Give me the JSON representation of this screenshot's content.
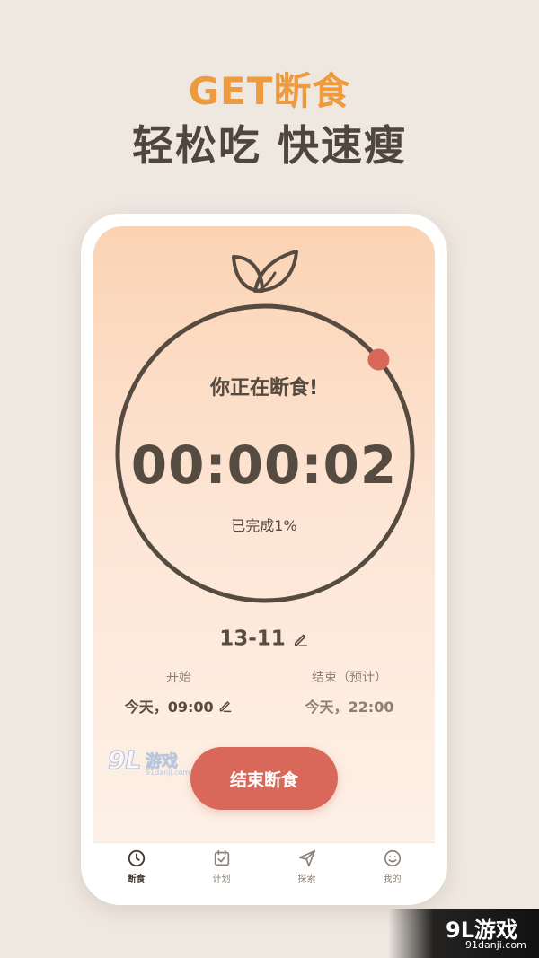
{
  "promo": {
    "title": "GET断食",
    "subtitle": "轻松吃 快速瘦"
  },
  "timer": {
    "status": "你正在断食!",
    "elapsed": "00:00:02",
    "progress_text": "已完成1%",
    "progress_fraction": 0.01
  },
  "plan": {
    "label": "13-11"
  },
  "start": {
    "label": "开始",
    "value": "今天，09:00"
  },
  "end": {
    "label": "结束（预计）",
    "value": "今天，22:00"
  },
  "action": {
    "end_fast_label": "结束断食"
  },
  "tabs": [
    {
      "label": "断食",
      "icon": "clock-icon",
      "active": true
    },
    {
      "label": "计划",
      "icon": "calendar-check-icon",
      "active": false
    },
    {
      "label": "探索",
      "icon": "send-icon",
      "active": false
    },
    {
      "label": "我的",
      "icon": "smile-icon",
      "active": false
    }
  ],
  "watermark": {
    "number": "9L",
    "name": "游戏",
    "url": "91danji.com",
    "corner_logo": "9L游戏",
    "corner_url": "91danji.com"
  },
  "colors": {
    "accent_orange": "#ee9a3f",
    "button_red": "#d9675a",
    "text_brown": "#564b40",
    "background": "#efe8e1"
  }
}
